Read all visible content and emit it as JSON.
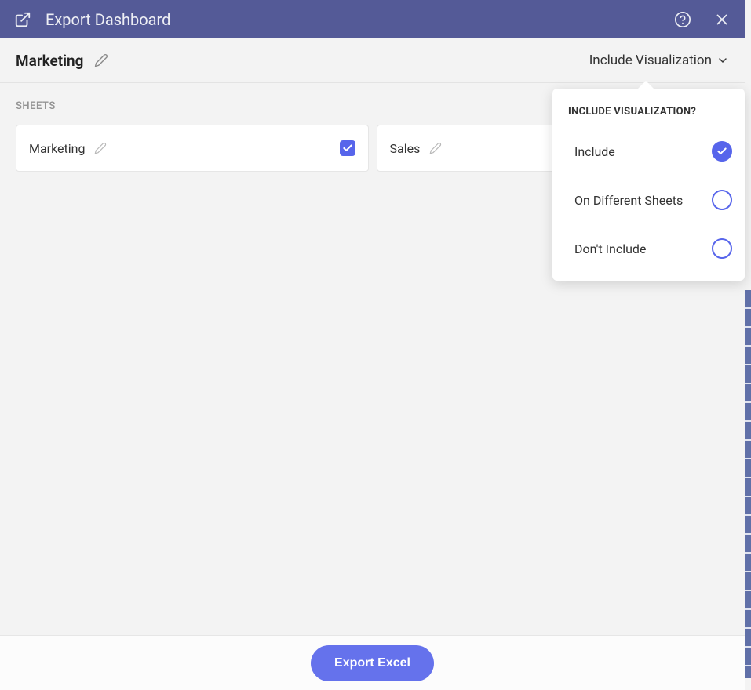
{
  "header": {
    "title": "Export Dashboard"
  },
  "subheader": {
    "title": "Marketing",
    "dropdown_label": "Include Visualization"
  },
  "sections": {
    "sheets_label": "SHEETS"
  },
  "sheets": [
    {
      "name": "Marketing",
      "checked": true
    },
    {
      "name": "Sales",
      "checked": false
    }
  ],
  "popover": {
    "title": "INCLUDE VISUALIZATION?",
    "options": [
      {
        "label": "Include",
        "selected": true
      },
      {
        "label": "On Different Sheets",
        "selected": false
      },
      {
        "label": "Don't Include",
        "selected": false
      }
    ]
  },
  "footer": {
    "export_label": "Export Excel"
  }
}
